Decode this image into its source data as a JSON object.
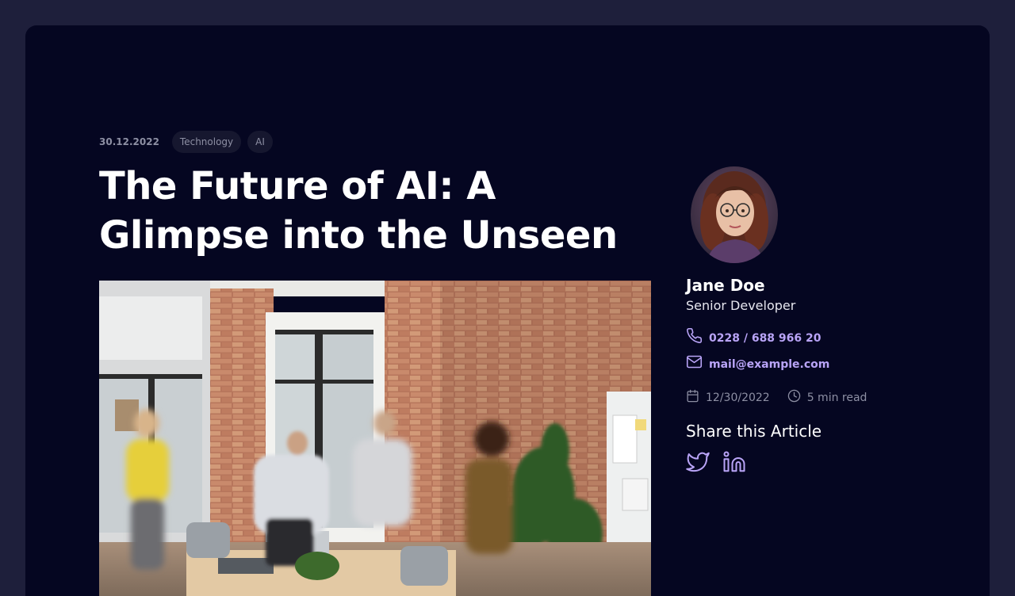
{
  "article": {
    "date": "30.12.2022",
    "tags": [
      "Technology",
      "AI"
    ],
    "title": "The Future of AI: A Glimpse into the Unseen"
  },
  "author": {
    "name": "Jane Doe",
    "role": "Senior Developer",
    "phone": "0228 / 688 966 20",
    "email": "mail@example.com"
  },
  "info": {
    "date": "12/30/2022",
    "read_time": "5 min read"
  },
  "share": {
    "title": "Share this Article",
    "icons": [
      "twitter-icon",
      "linkedin-icon"
    ]
  },
  "colors": {
    "background": "#1e1f3b",
    "card": "#050621",
    "accent": "#b9a4f7",
    "muted": "#8d8fa3"
  }
}
